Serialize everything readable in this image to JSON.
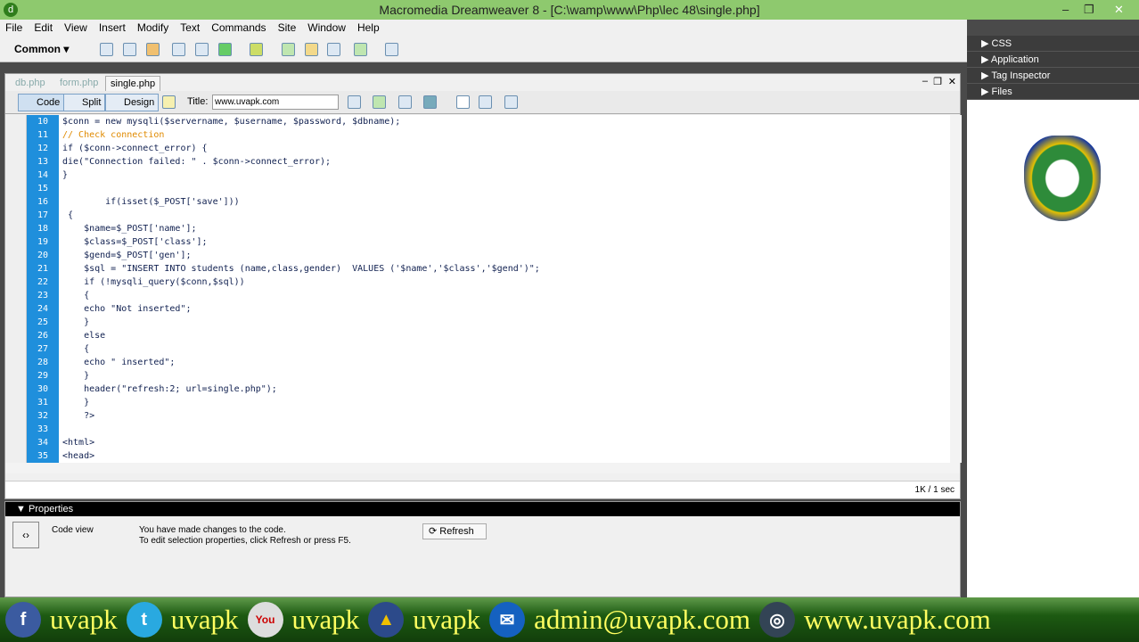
{
  "window": {
    "title": "Macromedia Dreamweaver 8 - [C:\\wamp\\www\\Php\\lec 48\\single.php]"
  },
  "menu": [
    "File",
    "Edit",
    "View",
    "Insert",
    "Modify",
    "Text",
    "Commands",
    "Site",
    "Window",
    "Help"
  ],
  "insert_bar": {
    "category": "Common"
  },
  "right_panels": [
    "CSS",
    "Application",
    "Tag Inspector",
    "Files"
  ],
  "tabs": [
    "db.php",
    "form.php",
    "single.php"
  ],
  "doc_toolbar": {
    "code": "Code",
    "split": "Split",
    "design": "Design",
    "title_label": "Title:",
    "title_value": "www.uvapk.com"
  },
  "code_lines": [
    {
      "n": "10",
      "t": "$conn = new mysqli($servername, $username, $password, $dbname);"
    },
    {
      "n": "11",
      "t": "// Check connection",
      "c": true
    },
    {
      "n": "12",
      "t": "if ($conn->connect_error) {"
    },
    {
      "n": "13",
      "t": "die(\"Connection failed: \" . $conn->connect_error);"
    },
    {
      "n": "14",
      "t": "}"
    },
    {
      "n": "15",
      "t": ""
    },
    {
      "n": "16",
      "t": "        if(isset($_POST['save']))"
    },
    {
      "n": "17",
      "t": " {"
    },
    {
      "n": "18",
      "t": "    $name=$_POST['name'];"
    },
    {
      "n": "19",
      "t": "    $class=$_POST['class'];"
    },
    {
      "n": "20",
      "t": "    $gend=$_POST['gen'];"
    },
    {
      "n": "21",
      "t": "    $sql = \"INSERT INTO students (name,class,gender)  VALUES ('$name','$class','$gend')\";"
    },
    {
      "n": "22",
      "t": "    if (!mysqli_query($conn,$sql))"
    },
    {
      "n": "23",
      "t": "    {"
    },
    {
      "n": "24",
      "t": "    echo \"Not inserted\";"
    },
    {
      "n": "25",
      "t": "    }"
    },
    {
      "n": "26",
      "t": "    else"
    },
    {
      "n": "27",
      "t": "    {"
    },
    {
      "n": "28",
      "t": "    echo \" inserted\";"
    },
    {
      "n": "29",
      "t": "    }"
    },
    {
      "n": "30",
      "t": "    header(\"refresh:2; url=single.php\");"
    },
    {
      "n": "31",
      "t": "    }"
    },
    {
      "n": "32",
      "t": "    ?>"
    },
    {
      "n": "33",
      "t": ""
    },
    {
      "n": "34",
      "t": "<html>"
    },
    {
      "n": "35",
      "t": "<head>"
    }
  ],
  "status": "1K / 1 sec",
  "properties": {
    "title": "Properties",
    "mode": "Code view",
    "msg1": "You have made changes to the code.",
    "msg2": "To edit selection properties, click Refresh or press F5.",
    "refresh": "Refresh"
  },
  "banner": {
    "fb": "uvapk",
    "tw": "uvapk",
    "yt": "uvapk",
    "other": "uvapk",
    "email": "admin@uvapk.com",
    "web": "www.uvapk.com"
  }
}
